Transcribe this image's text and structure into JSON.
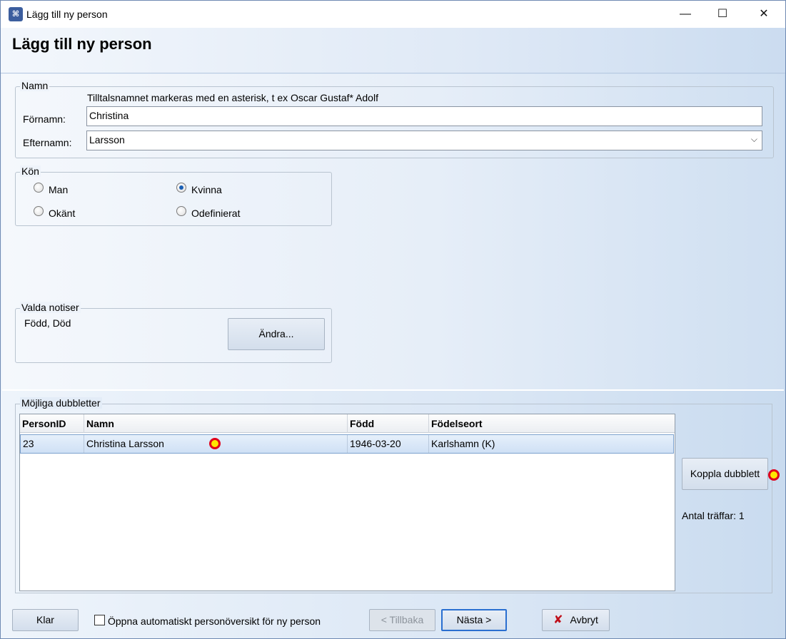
{
  "window": {
    "title": "Lägg till ny person",
    "app_icon": "tree-icon",
    "minimize_glyph": "—",
    "maximize_glyph": "☐",
    "close_glyph": "✕"
  },
  "header": {
    "title": "Lägg till ny person"
  },
  "name_group": {
    "legend": "Namn",
    "hint": "Tilltalsnamnet markeras med en asterisk, t ex  Oscar Gustaf* Adolf",
    "first_name": {
      "label": "Förnamn:",
      "value": "Christina"
    },
    "last_name": {
      "label": "Efternamn:",
      "value": "Larsson"
    }
  },
  "gender_group": {
    "legend": "Kön",
    "options": [
      {
        "label": "Man",
        "checked": false
      },
      {
        "label": "Kvinna",
        "checked": true
      },
      {
        "label": "Okänt",
        "checked": false
      },
      {
        "label": "Odefinierat",
        "checked": false
      }
    ]
  },
  "notices_group": {
    "legend": "Valda notiser",
    "value": "Född, Död",
    "change_button": "Ändra..."
  },
  "duplicates": {
    "legend": "Möjliga dubbletter",
    "columns": [
      "PersonID",
      "Namn",
      "Född",
      "Födelseort"
    ],
    "rows": [
      {
        "person_id": "23",
        "name": "Christina Larsson",
        "born": "1946-03-20",
        "birthplace": "Karlshamn (K)"
      }
    ],
    "link_button": "Koppla dubblett",
    "hits_label": "Antal träffar: 1",
    "marker_color": "#ffe600",
    "marker_ring_color": "#e0001a"
  },
  "footer": {
    "done_button": "Klar",
    "auto_open_label": "Öppna automatiskt personöversikt för ny person",
    "auto_open_checked": false,
    "back_button": "< Tillbaka",
    "next_button": "Nästa >",
    "cancel_button": "Avbryt",
    "cancel_icon_color": "#c0101a"
  }
}
